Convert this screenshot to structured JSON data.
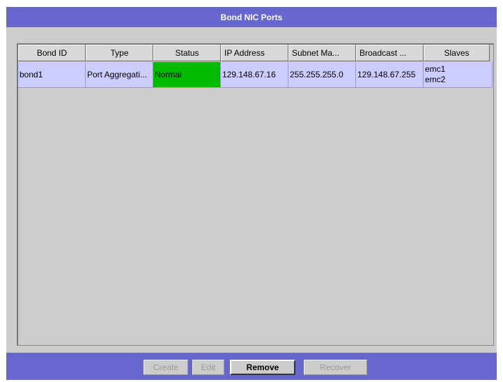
{
  "panel": {
    "title": "Bond NIC Ports"
  },
  "table": {
    "columns": [
      "Bond ID",
      "Type",
      "Status",
      "IP Address",
      "Subnet Ma...",
      "Broadcast ...",
      "Slaves"
    ],
    "rows": [
      {
        "bond_id": "bond1",
        "type": "Port Aggregati...",
        "status": "Normal",
        "ip_address": "129.148.67.16",
        "subnet_mask": "255.255.255.0",
        "broadcast": "129.148.67.255",
        "slaves": [
          "emc1",
          "emc2"
        ]
      }
    ]
  },
  "buttons": {
    "create": "Create",
    "edit": "Edit",
    "remove": "Remove",
    "recover": "Recover"
  },
  "colors": {
    "title_bar": "#6666cc",
    "row_selected": "#ccccff",
    "status_normal": "#00bb00",
    "panel_background": "#cccccc"
  }
}
